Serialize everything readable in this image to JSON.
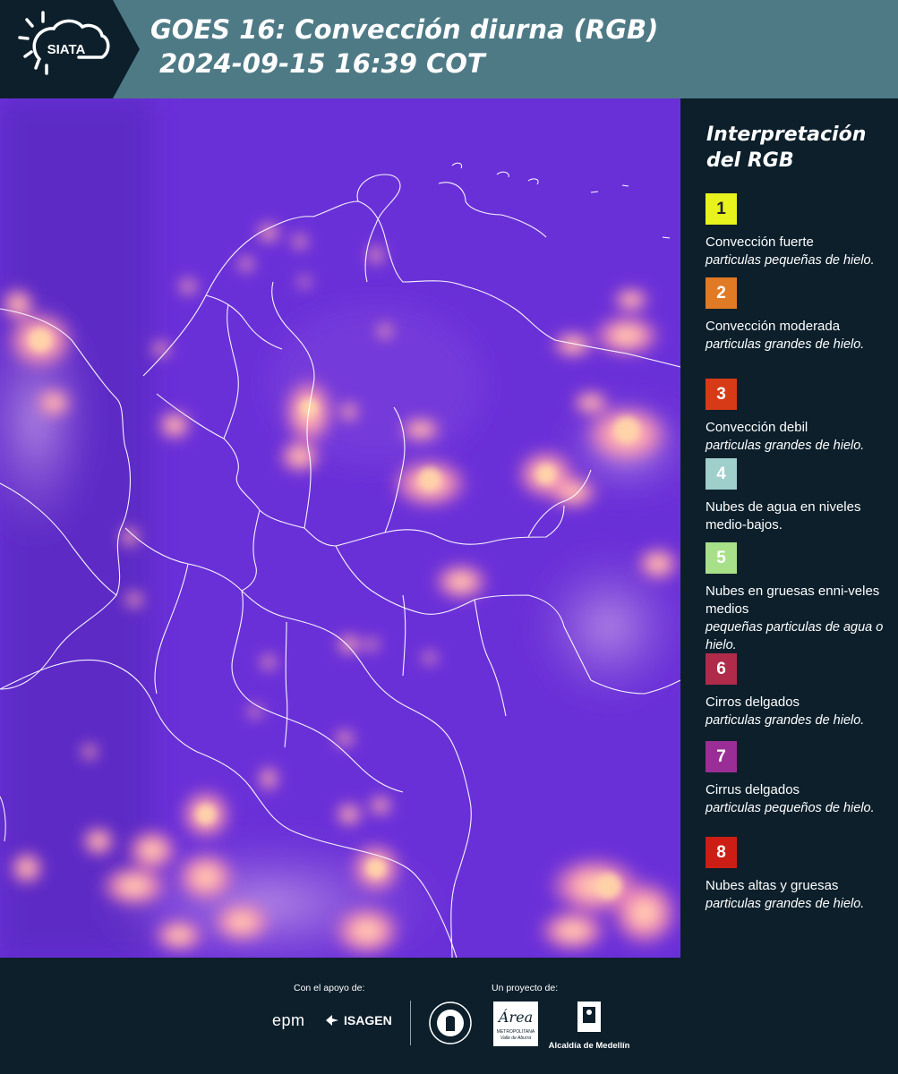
{
  "header": {
    "logo_text": "SIATA",
    "title_line1": "GOES 16: Convección diurna (RGB)",
    "title_line2": "2024-09-15 16:39 COT",
    "background": "#4e7a86"
  },
  "map": {
    "background": "#6a2fd6",
    "icon": "satellite-map"
  },
  "legend": {
    "title_line1": "Interpretación",
    "title_line2": "del RGB",
    "items": [
      {
        "number": "1",
        "color": "#e8f21c",
        "text_color": "#222222",
        "label": "Convección fuerte",
        "sub": "particulas pequeñas de hielo."
      },
      {
        "number": "2",
        "color": "#e07a25",
        "text_color": "#ffffff",
        "label": "Convección moderada",
        "sub": "particulas grandes de hielo."
      },
      {
        "number": "3",
        "color": "#d63a16",
        "text_color": "#ffffff",
        "label": "Convección debil",
        "sub": "particulas grandes de hielo."
      },
      {
        "number": "4",
        "color": "#9ecfcb",
        "text_color": "#ffffff",
        "label": "Nubes de agua en niveles medio-bajos.",
        "sub": ""
      },
      {
        "number": "5",
        "color": "#a8e08a",
        "text_color": "#ffffff",
        "label": "Nubes en gruesas enni-veles medios",
        "sub": "pequeñas particulas de agua o hielo."
      },
      {
        "number": "6",
        "color": "#b02a4a",
        "text_color": "#ffffff",
        "label": "Cirros delgados",
        "sub": "particulas grandes de hielo."
      },
      {
        "number": "7",
        "color": "#9a2d96",
        "text_color": "#ffffff",
        "label": "Cirrus delgados",
        "sub": "particulas pequeños de hielo."
      },
      {
        "number": "8",
        "color": "#cc1e14",
        "text_color": "#ffffff",
        "label": "Nubes altas y gruesas",
        "sub": "particulas grandes de hielo."
      }
    ]
  },
  "footer": {
    "support_label": "Con el apoyo de:",
    "project_label": "Un proyecto de:",
    "epm_text": "epm",
    "isagen_text": "ISAGEN",
    "area_text": "Área",
    "area_sub1": "METROPOLITANA",
    "area_sub2": "Valle de Aburrá",
    "alcaldia_text": "Alcaldía de Medellín"
  }
}
